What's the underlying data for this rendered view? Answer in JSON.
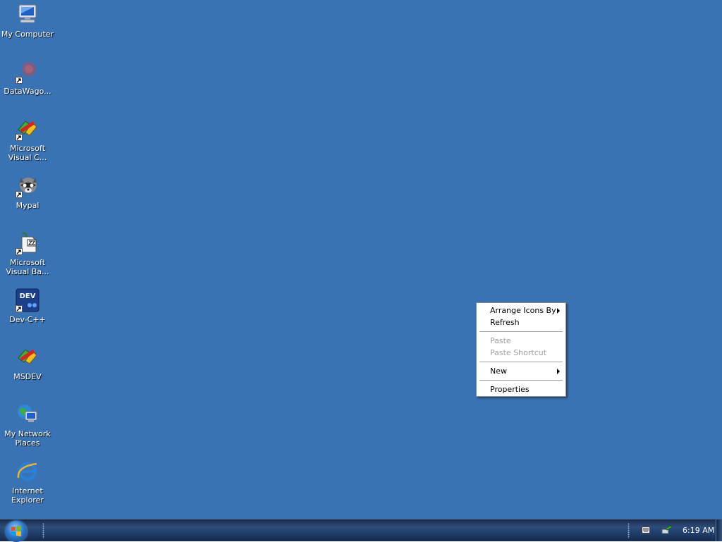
{
  "desktop": {
    "background_color": "#3a73b3",
    "icons": [
      {
        "label": "My Computer",
        "icon": "my-computer-icon",
        "shortcut": false
      },
      {
        "label": "DataWago...",
        "icon": "datawago-icon",
        "shortcut": true
      },
      {
        "label": "Microsoft\nVisual C...",
        "icon": "visual-c-icon",
        "shortcut": true
      },
      {
        "label": "Mypal",
        "icon": "mypal-icon",
        "shortcut": true
      },
      {
        "label": "Microsoft\nVisual Ba...",
        "icon": "visual-basic-icon",
        "shortcut": true
      },
      {
        "label": "Dev-C++",
        "icon": "dev-cpp-icon",
        "shortcut": true
      },
      {
        "label": "MSDEV",
        "icon": "msdev-icon",
        "shortcut": false
      },
      {
        "label": "My Network\nPlaces",
        "icon": "network-places-icon",
        "shortcut": false
      },
      {
        "label": "Internet\nExplorer",
        "icon": "internet-explorer-icon",
        "shortcut": false
      }
    ]
  },
  "context_menu": {
    "arrange_icons_by": "Arrange Icons By",
    "refresh": "Refresh",
    "paste": "Paste",
    "paste_shortcut": "Paste Shortcut",
    "new": "New",
    "properties": "Properties"
  },
  "taskbar": {
    "start_icon": "windows-orb-icon",
    "clock": "6:19 AM"
  }
}
